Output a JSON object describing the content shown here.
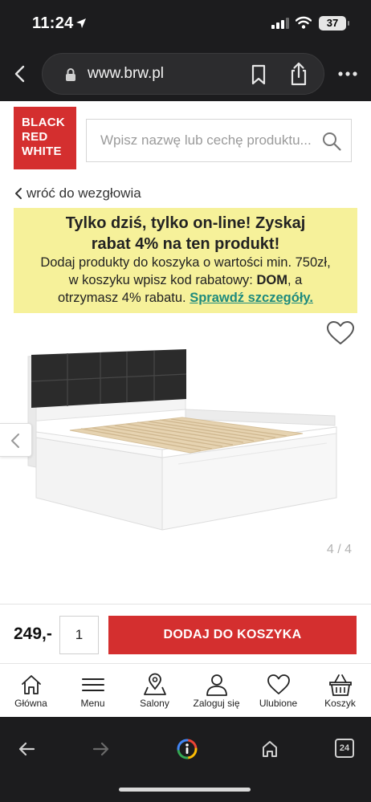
{
  "status": {
    "time": "11:24",
    "battery": "37"
  },
  "browser": {
    "url": "www.brw.pl",
    "tab_count": "24"
  },
  "site": {
    "logo_lines": [
      "BLACK",
      "RED",
      "WHITE"
    ],
    "brand_color": "#d42f2f",
    "search_placeholder": "Wpisz nazwę lub cechę produktu..."
  },
  "breadcrumb": {
    "back_label": "wróć do wezgłowia"
  },
  "promo": {
    "title": "Tylko dziś, tylko on-line! Zyskaj rabat 4% na ten produkt!",
    "body_before_code": "Dodaj produkty do koszyka o wartości min. 750zł, w koszyku wpisz kod rabatowy: ",
    "code": "DOM",
    "body_after_code": ", a otrzymasz 4% rabatu. ",
    "link_label": "Sprawdź szczegóły.",
    "background_color": "#f6f19a",
    "link_color": "#1f8b7d"
  },
  "gallery": {
    "counter": "4 / 4"
  },
  "purchase": {
    "price": "249,-",
    "quantity": "1",
    "add_to_cart_label": "DODAJ DO KOSZYKA"
  },
  "nav": {
    "items": [
      {
        "label": "Główna",
        "icon": "home-icon"
      },
      {
        "label": "Menu",
        "icon": "menu-icon"
      },
      {
        "label": "Salony",
        "icon": "location-icon"
      },
      {
        "label": "Zaloguj się",
        "icon": "user-icon"
      },
      {
        "label": "Ulubione",
        "icon": "heart-icon"
      },
      {
        "label": "Koszyk",
        "icon": "basket-icon"
      }
    ]
  }
}
